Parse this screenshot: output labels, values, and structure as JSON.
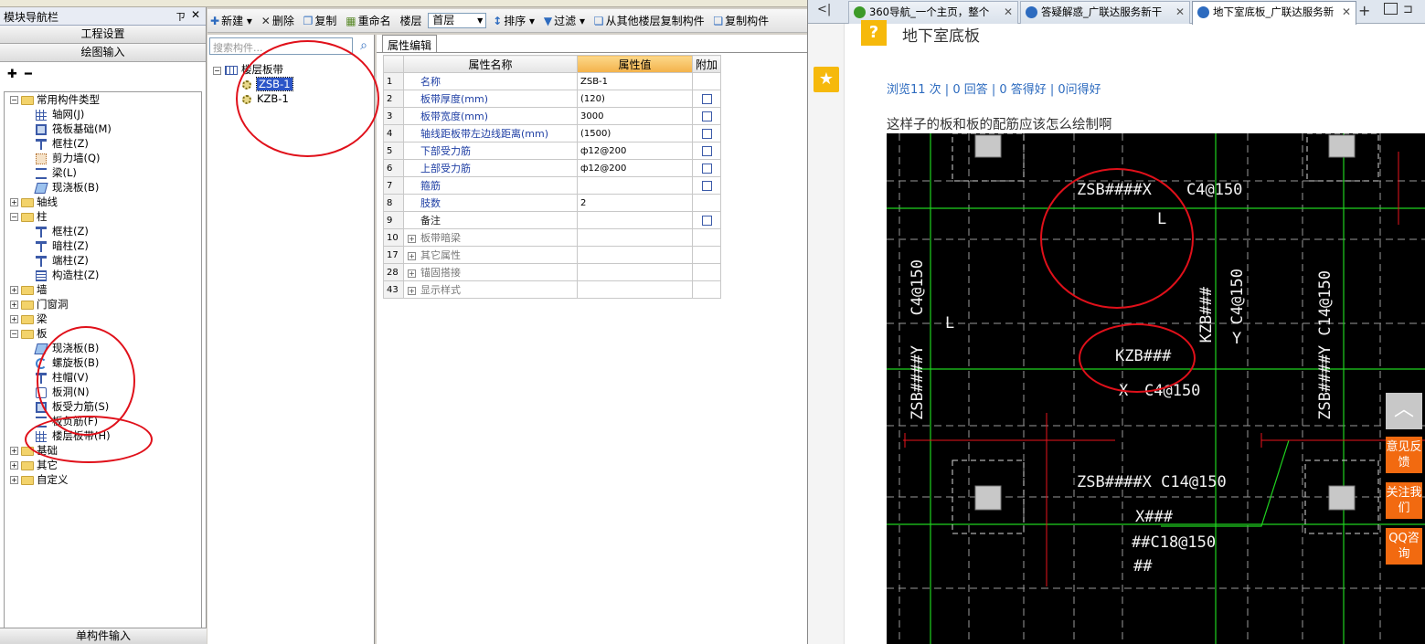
{
  "nav": {
    "title": "模块导航栏",
    "pin": "ㄗ",
    "close": "✕",
    "btn_project": "工程设置",
    "btn_draw": "绘图输入",
    "tools": "✚ ━",
    "bottom": "单构件输入",
    "tree": [
      {
        "label": "常用构件类型",
        "level": 0,
        "kind": "folder",
        "exp": "-"
      },
      {
        "label": "轴网(J)",
        "level": 1,
        "kind": "grid"
      },
      {
        "label": "筏板基础(M)",
        "level": 1,
        "kind": "raft"
      },
      {
        "label": "框柱(Z)",
        "level": 1,
        "kind": "col"
      },
      {
        "label": "剪力墙(Q)",
        "level": 1,
        "kind": "wall"
      },
      {
        "label": "梁(L)",
        "level": 1,
        "kind": "beam"
      },
      {
        "label": "现浇板(B)",
        "level": 1,
        "kind": "slab"
      },
      {
        "label": "轴线",
        "level": 0,
        "kind": "folder",
        "exp": "+"
      },
      {
        "label": "柱",
        "level": 0,
        "kind": "folder",
        "exp": "-"
      },
      {
        "label": "框柱(Z)",
        "level": 1,
        "kind": "col"
      },
      {
        "label": "暗柱(Z)",
        "level": 1,
        "kind": "col"
      },
      {
        "label": "端柱(Z)",
        "level": 1,
        "kind": "col"
      },
      {
        "label": "构造柱(Z)",
        "level": 1,
        "kind": "gz"
      },
      {
        "label": "墙",
        "level": 0,
        "kind": "folder",
        "exp": "+"
      },
      {
        "label": "门窗洞",
        "level": 0,
        "kind": "folder",
        "exp": "+"
      },
      {
        "label": "梁",
        "level": 0,
        "kind": "folder",
        "exp": "+"
      },
      {
        "label": "板",
        "level": 0,
        "kind": "folder",
        "exp": "-"
      },
      {
        "label": "现浇板(B)",
        "level": 1,
        "kind": "slab"
      },
      {
        "label": "螺旋板(B)",
        "level": 1,
        "kind": "spiral"
      },
      {
        "label": "柱帽(V)",
        "level": 1,
        "kind": "col"
      },
      {
        "label": "板洞(N)",
        "level": 1,
        "kind": "hole"
      },
      {
        "label": "板受力筋(S)",
        "level": 1,
        "kind": "raft"
      },
      {
        "label": "板负筋(F)",
        "level": 1,
        "kind": "beam"
      },
      {
        "label": "楼层板带(H)",
        "level": 1,
        "kind": "grid"
      },
      {
        "label": "基础",
        "level": 0,
        "kind": "folder",
        "exp": "+"
      },
      {
        "label": "其它",
        "level": 0,
        "kind": "folder",
        "exp": "+"
      },
      {
        "label": "自定义",
        "level": 0,
        "kind": "folder",
        "exp": "+"
      }
    ]
  },
  "toolbar": {
    "new": "新建",
    "delete": "删除",
    "copy": "复制",
    "rename": "重命名",
    "floor_label": "楼层",
    "floor_value": "首层",
    "sort": "排序",
    "filter": "过滤",
    "copy_from_floor": "从其他楼层复制构件",
    "copy_to": "复制构件"
  },
  "list": {
    "search_placeholder": "搜索构件...",
    "root": "楼层板带",
    "items": [
      "ZSB-1",
      "KZB-1"
    ]
  },
  "prop": {
    "tab": "属性编辑",
    "headers": [
      "属性名称",
      "属性值",
      "附加"
    ],
    "rows": [
      {
        "no": "1",
        "name": "名称",
        "value": "ZSB-1",
        "cb": false,
        "style": "blue"
      },
      {
        "no": "2",
        "name": "板带厚度(mm)",
        "value": "(120)",
        "cb": true,
        "style": "blue"
      },
      {
        "no": "3",
        "name": "板带宽度(mm)",
        "value": "3000",
        "cb": true,
        "style": "blue"
      },
      {
        "no": "4",
        "name": "轴线距板带左边线距离(mm)",
        "value": "(1500)",
        "cb": true,
        "style": "blue"
      },
      {
        "no": "5",
        "name": "下部受力筋",
        "value": "ф12@200",
        "cb": true,
        "style": "blue"
      },
      {
        "no": "6",
        "name": "上部受力筋",
        "value": "ф12@200",
        "cb": true,
        "style": "blue"
      },
      {
        "no": "7",
        "name": "箍筋",
        "value": "",
        "cb": true,
        "style": "blue"
      },
      {
        "no": "8",
        "name": "肢数",
        "value": "2",
        "cb": false,
        "style": "blue"
      },
      {
        "no": "9",
        "name": "备注",
        "value": "",
        "cb": true,
        "style": "black"
      },
      {
        "no": "10",
        "name": "板带暗梁",
        "value": "",
        "cb": false,
        "style": "grey"
      },
      {
        "no": "17",
        "name": "其它属性",
        "value": "",
        "cb": false,
        "style": "grey"
      },
      {
        "no": "28",
        "name": "锚固搭接",
        "value": "",
        "cb": false,
        "style": "grey"
      },
      {
        "no": "43",
        "name": "显示样式",
        "value": "",
        "cb": false,
        "style": "grey"
      }
    ]
  },
  "browser": {
    "back": "<|",
    "tabs": [
      {
        "title": "360导航_一个主页，整个",
        "active": false,
        "fav": "#3c9a28"
      },
      {
        "title": "答疑解惑_广联达服务新干",
        "active": false,
        "fav": "#2d6bbf"
      },
      {
        "title": "地下室底板_广联达服务新",
        "active": true,
        "fav": "#2d6bbf"
      }
    ],
    "plus": "+",
    "q_icon": "?",
    "q_title": "地下室底板",
    "stats": "浏览11 次 | 0 回答 | 0 答得好 | 0问得好",
    "question": "这样子的板和板的配筋应该怎么绘制啊",
    "star": "★",
    "side_buttons": [
      "意见反馈",
      "关注我们",
      "QQ咨询"
    ],
    "to_top": "︿",
    "cad_labels": {
      "zsb_top": "ZSB####X",
      "c4_top": "C4@150",
      "l_top": "L",
      "c4_left": "C4@150",
      "l_left": "L",
      "zsb_left": "ZSB####Y",
      "kzb_vert": "KZB###",
      "c4_mid": "C4@150",
      "y_mid": "Y",
      "kzb_mid": "KZB###",
      "x_mid": "X",
      "c4_mid2": "C4@150",
      "zsb_right": "ZSB####Y C14@150",
      "zsb_bottom": "ZSB####X C14@150",
      "x_bot": "X###",
      "c18": "##C18@150",
      "bot3": "##"
    }
  }
}
